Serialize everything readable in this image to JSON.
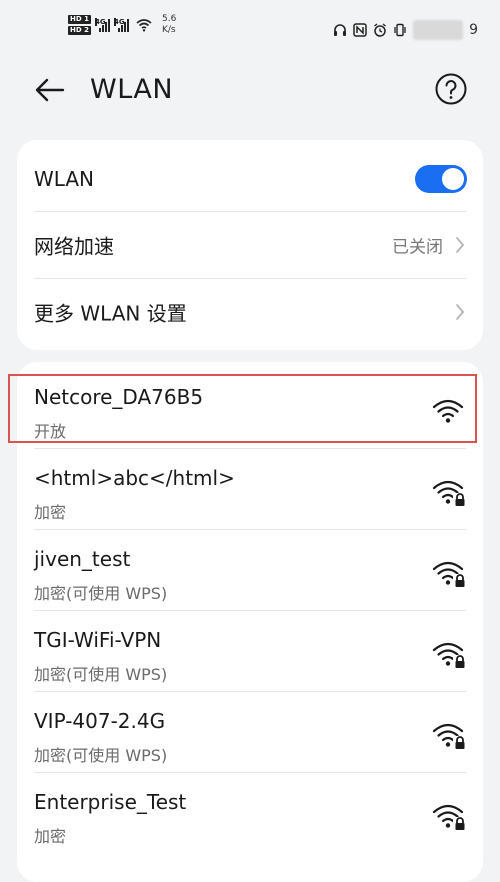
{
  "status_bar": {
    "hd1": "HD 1",
    "hd2": "HD 2",
    "net1": "4G",
    "net2": "4G",
    "speed_value": "5.6",
    "speed_unit": "K/s",
    "battery_partial": "9"
  },
  "header": {
    "title": "WLAN"
  },
  "settings": {
    "wlan_label": "WLAN",
    "wlan_enabled": true,
    "accel_label": "网络加速",
    "accel_value": "已关闭",
    "more_label": "更多 WLAN 设置"
  },
  "networks": [
    {
      "name": "Netcore_DA76B5",
      "security": "开放",
      "locked": false
    },
    {
      "name": "<html>abc</html>",
      "security": "加密",
      "locked": true
    },
    {
      "name": "jiven_test",
      "security": "加密(可使用 WPS)",
      "locked": true
    },
    {
      "name": "TGI-WiFi-VPN",
      "security": "加密(可使用 WPS)",
      "locked": true
    },
    {
      "name": "VIP-407-2.4G",
      "security": "加密(可使用 WPS)",
      "locked": true
    },
    {
      "name": "Enterprise_Test",
      "security": "加密",
      "locked": true
    }
  ],
  "colors": {
    "accent": "#1a6ef2",
    "highlight": "#d9534f",
    "background": "#f1f3f5"
  }
}
